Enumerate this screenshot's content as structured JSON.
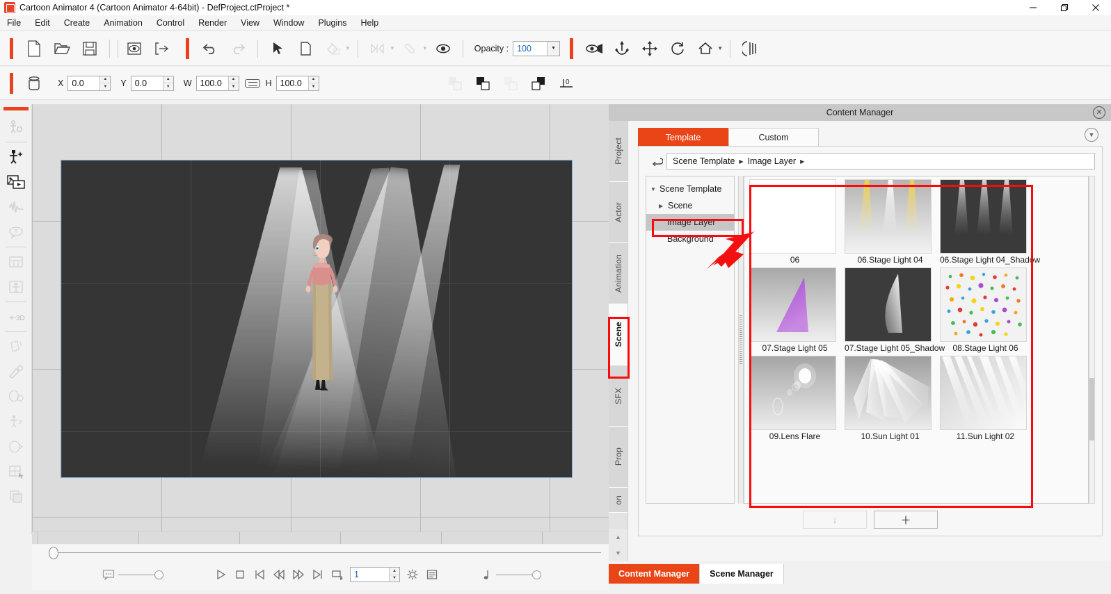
{
  "window": {
    "title": "Cartoon Animator 4  (Cartoon Animator 4-64bit) - DefProject.ctProject *",
    "minimize": "—",
    "maximize": "❐",
    "close": "✕"
  },
  "menubar": {
    "items": [
      "File",
      "Edit",
      "Create",
      "Animation",
      "Control",
      "Render",
      "View",
      "Window",
      "Plugins",
      "Help"
    ]
  },
  "toolbar": {
    "opacity_label": "Opacity :",
    "opacity_value": "100",
    "icons_row1": [
      "new-file-icon",
      "open-folder-icon",
      "save-icon",
      "preview-icon",
      "export-icon",
      "undo-icon",
      "redo-icon",
      "select-arrow-icon",
      "page-icon",
      "paint-bucket-icon",
      "keyframe-nav-icon",
      "link-icon",
      "eye-icon"
    ],
    "icons_row1_right": [
      "camera-eye-icon",
      "anchor-icon",
      "move-icon",
      "rotate-icon",
      "home-icon",
      "filmstrip-icon"
    ]
  },
  "transform": {
    "x_label": "X",
    "x_value": "0.0",
    "y_label": "Y",
    "y_value": "0.0",
    "w_label": "W",
    "w_value": "100.0",
    "h_label": "H",
    "h_value": "100.0",
    "link_icon": "link-aspect-icon",
    "align_icons": [
      "align-back-icon",
      "align-front-icon",
      "align-behind-icon",
      "align-above-icon",
      "ground-zero-icon"
    ],
    "ground_label": "0"
  },
  "left_toolbar": {
    "items": [
      "character-settings-icon",
      "create-actor-icon",
      "media-layer-icon",
      "audio-wave-icon",
      "speech-bubble-icon",
      "sprite-sheet-icon",
      "face-puppet-icon",
      "3d-icon",
      "transform-icon",
      "pen-motion-icon",
      "head-puppet-icon",
      "body-puppet-icon",
      "face-key-icon",
      "mesh-icon",
      "layer-icon"
    ]
  },
  "canvas": {
    "scene_name": "stage-spotlight-scene",
    "character": "female-character"
  },
  "timeline": {
    "frame_value": "1",
    "transport_buttons": [
      "play-icon",
      "stop-icon",
      "first-frame-icon",
      "prev-frame-icon",
      "next-frame-icon",
      "last-frame-icon",
      "loop-icon"
    ],
    "settings_icon": "gear-icon",
    "timeline-list-icon": "timeline-list-icon",
    "bubble_icon": "speech-bubble-small-icon",
    "note_icon": "music-note-icon"
  },
  "content_manager": {
    "title": "Content Manager",
    "close_icon": "close-circle-icon",
    "collapse_icon": "chevron-down-circle-icon",
    "vertical_tabs": [
      {
        "label": "Project",
        "active": false
      },
      {
        "label": "Actor",
        "active": false
      },
      {
        "label": "Animation",
        "active": false
      },
      {
        "label": "Scene",
        "active": true
      },
      {
        "label": "SFX",
        "active": false
      },
      {
        "label": "Prop",
        "active": false
      },
      {
        "label": "on",
        "active": false
      }
    ],
    "tabs": [
      {
        "label": "Template",
        "active": true
      },
      {
        "label": "Custom",
        "active": false
      }
    ],
    "back_icon": "back-arrow-icon",
    "breadcrumb": [
      "Scene Template",
      "Image Layer"
    ],
    "tree": [
      {
        "label": "Scene Template",
        "level": 1,
        "expanded": true,
        "selected": false
      },
      {
        "label": "Scene",
        "level": 2,
        "expanded": false,
        "selected": false
      },
      {
        "label": "Image Layer",
        "level": 3,
        "expanded": null,
        "selected": true
      },
      {
        "label": "Background",
        "level": 3,
        "expanded": null,
        "selected": false
      }
    ],
    "assets": [
      {
        "name": "06",
        "thumb": "blank-white"
      },
      {
        "name": "06.Stage Light 04",
        "thumb": "yellow-beams-light"
      },
      {
        "name": "06.Stage Light 04_Shadow",
        "thumb": "grey-beams-dark"
      },
      {
        "name": "07.Stage Light 05",
        "thumb": "purple-cone-light"
      },
      {
        "name": "07.Stage Light 05_Shadow",
        "thumb": "white-cone-dark"
      },
      {
        "name": "08.Stage Light 06",
        "thumb": "colored-dots"
      },
      {
        "name": "09.Lens Flare",
        "thumb": "lens-flare"
      },
      {
        "name": "10.Sun Light 01",
        "thumb": "sun-rays-corner"
      },
      {
        "name": "11.Sun Light 02",
        "thumb": "sun-rays-diagonal"
      }
    ],
    "footer_buttons": [
      {
        "label": "↓",
        "name": "download-button",
        "disabled": true
      },
      {
        "label": "＋",
        "name": "add-button",
        "disabled": false
      }
    ]
  },
  "bottom_tabs": [
    {
      "label": "Content Manager",
      "active": true
    },
    {
      "label": "Scene Manager",
      "active": false
    }
  ],
  "colors": {
    "accent": "#ea4516",
    "annotation": "#fa0a0a",
    "title_bar": "#c8c8c8"
  }
}
